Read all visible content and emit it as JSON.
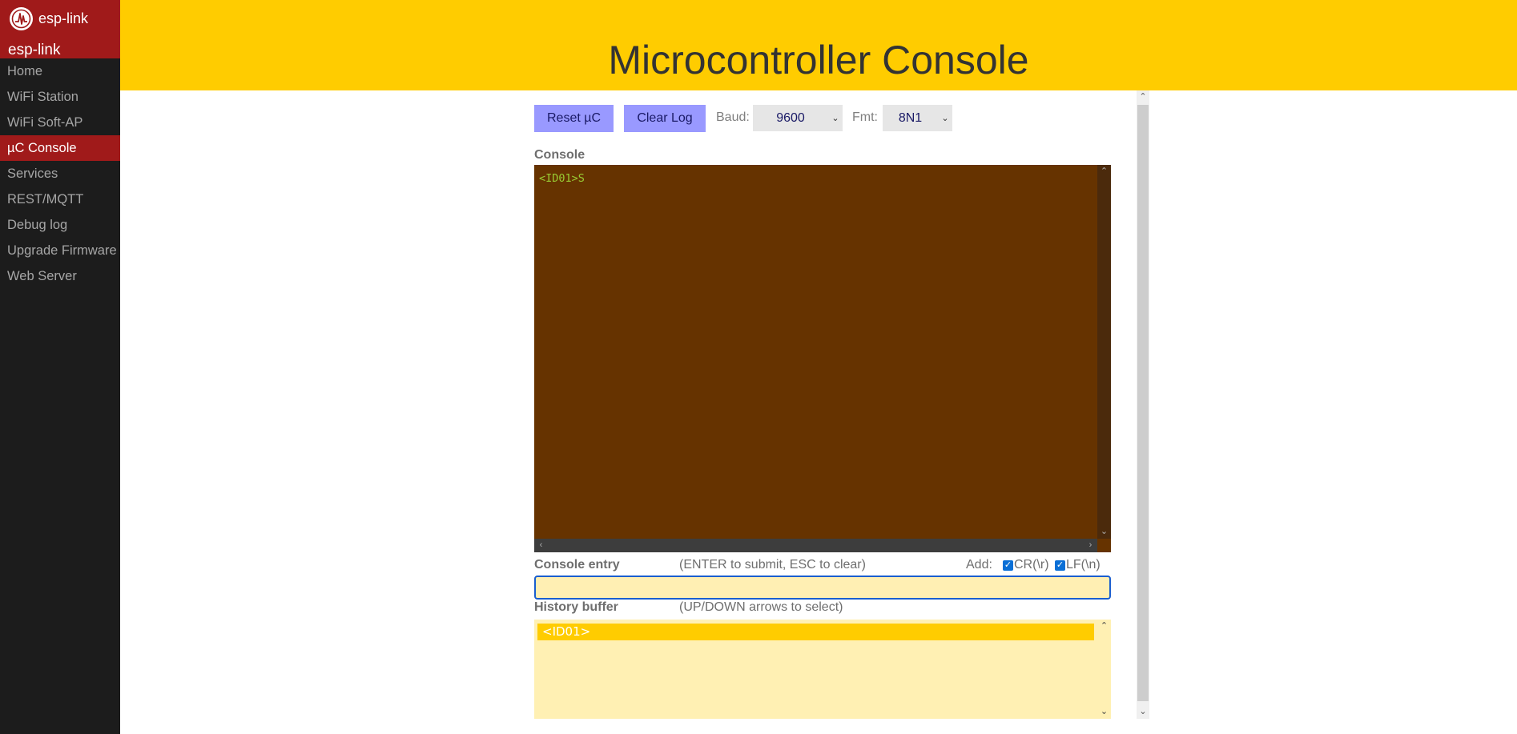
{
  "brand": {
    "top_name": "esp-link",
    "sub_name": "esp-link"
  },
  "nav": {
    "items": [
      {
        "label": "Home"
      },
      {
        "label": "WiFi Station"
      },
      {
        "label": "WiFi Soft-AP"
      },
      {
        "label": "µC Console"
      },
      {
        "label": "Services"
      },
      {
        "label": "REST/MQTT"
      },
      {
        "label": "Debug log"
      },
      {
        "label": "Upgrade Firmware"
      },
      {
        "label": "Web Server"
      }
    ],
    "active_index": 3
  },
  "header": {
    "title": "Microcontroller Console"
  },
  "toolbar": {
    "reset_label": "Reset µC",
    "clear_label": "Clear Log",
    "baud_label": "Baud:",
    "baud_value": "9600",
    "fmt_label": "Fmt:",
    "fmt_value": "8N1"
  },
  "console": {
    "label": "Console",
    "text": "<ID01>S"
  },
  "entry": {
    "label": "Console entry",
    "hint": "(ENTER to submit, ESC to clear)",
    "add_label": "Add:",
    "cr_label": "CR(\\r)",
    "lf_label": "LF(\\n)",
    "cr_checked": true,
    "lf_checked": true,
    "value": ""
  },
  "history": {
    "label": "History buffer",
    "hint": "(UP/DOWN arrows to select)",
    "items": [
      "<ID01>"
    ]
  },
  "colors": {
    "header": "#ffcc00",
    "sidebar": "#1c1c1c",
    "brand": "#a01a1a",
    "console_bg": "#663300",
    "console_text": "#99cc33",
    "button": "#9999ff"
  },
  "icons": {
    "brand": "esp-link-logo-icon",
    "chevron": "chevron-down-icon",
    "checkbox": "checkmark-icon"
  }
}
